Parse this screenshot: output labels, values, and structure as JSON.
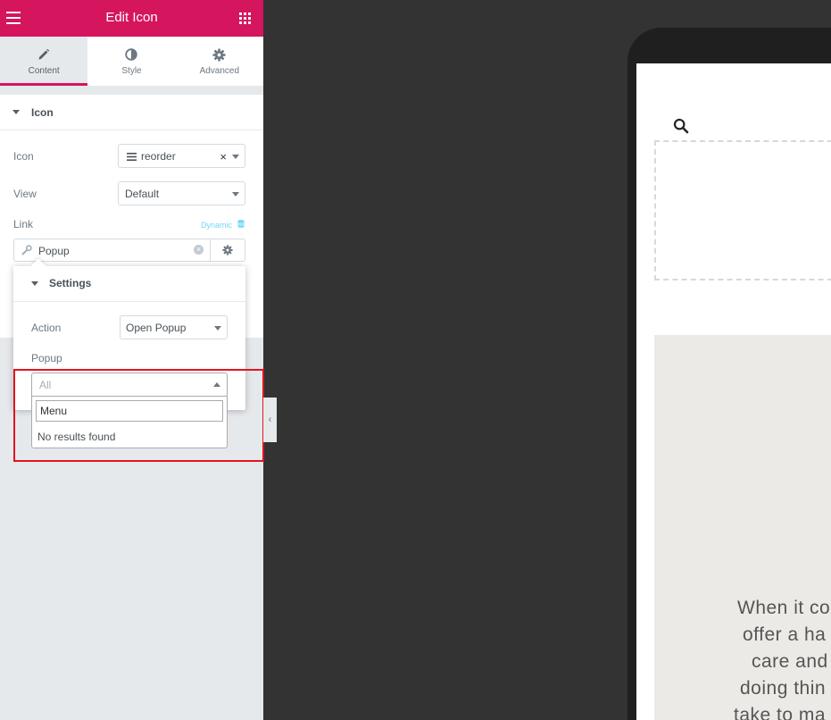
{
  "header": {
    "title": "Edit Icon"
  },
  "tabs": [
    {
      "label": "Content",
      "icon": "pencil-icon",
      "active": true
    },
    {
      "label": "Style",
      "icon": "contrast-icon",
      "active": false
    },
    {
      "label": "Advanced",
      "icon": "gear-icon",
      "active": false
    }
  ],
  "section": {
    "title": "Icon"
  },
  "controls": {
    "icon": {
      "label": "Icon",
      "value": "reorder",
      "clear": "×"
    },
    "view": {
      "label": "View",
      "value": "Default"
    },
    "link": {
      "label": "Link",
      "dynamic": "Dynamic",
      "value": "Popup"
    }
  },
  "popover": {
    "title": "Settings",
    "action": {
      "label": "Action",
      "value": "Open Popup"
    },
    "popup": {
      "label": "Popup",
      "placeholder": "All",
      "search_value": "Menu",
      "empty_text": "No results found"
    }
  },
  "preview": {
    "hero_lines": [
      "When it co",
      "offer a ha",
      "care and",
      "doing thin",
      "take to ma"
    ]
  },
  "colors": {
    "accent": "#d5155e",
    "highlight": "#e0141e",
    "dynamic": "#71d7f7"
  }
}
